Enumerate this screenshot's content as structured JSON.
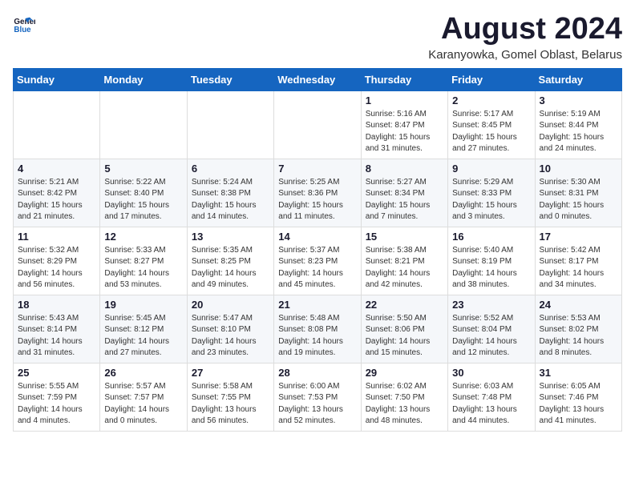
{
  "logo": {
    "line1": "General",
    "line2": "Blue"
  },
  "title": {
    "month_year": "August 2024",
    "location": "Karanyowka, Gomel Oblast, Belarus"
  },
  "weekdays": [
    "Sunday",
    "Monday",
    "Tuesday",
    "Wednesday",
    "Thursday",
    "Friday",
    "Saturday"
  ],
  "weeks": [
    [
      {
        "day": "",
        "sunrise": "",
        "sunset": "",
        "daylight": ""
      },
      {
        "day": "",
        "sunrise": "",
        "sunset": "",
        "daylight": ""
      },
      {
        "day": "",
        "sunrise": "",
        "sunset": "",
        "daylight": ""
      },
      {
        "day": "",
        "sunrise": "",
        "sunset": "",
        "daylight": ""
      },
      {
        "day": "1",
        "sunrise": "Sunrise: 5:16 AM",
        "sunset": "Sunset: 8:47 PM",
        "daylight": "Daylight: 15 hours and 31 minutes."
      },
      {
        "day": "2",
        "sunrise": "Sunrise: 5:17 AM",
        "sunset": "Sunset: 8:45 PM",
        "daylight": "Daylight: 15 hours and 27 minutes."
      },
      {
        "day": "3",
        "sunrise": "Sunrise: 5:19 AM",
        "sunset": "Sunset: 8:44 PM",
        "daylight": "Daylight: 15 hours and 24 minutes."
      }
    ],
    [
      {
        "day": "4",
        "sunrise": "Sunrise: 5:21 AM",
        "sunset": "Sunset: 8:42 PM",
        "daylight": "Daylight: 15 hours and 21 minutes."
      },
      {
        "day": "5",
        "sunrise": "Sunrise: 5:22 AM",
        "sunset": "Sunset: 8:40 PM",
        "daylight": "Daylight: 15 hours and 17 minutes."
      },
      {
        "day": "6",
        "sunrise": "Sunrise: 5:24 AM",
        "sunset": "Sunset: 8:38 PM",
        "daylight": "Daylight: 15 hours and 14 minutes."
      },
      {
        "day": "7",
        "sunrise": "Sunrise: 5:25 AM",
        "sunset": "Sunset: 8:36 PM",
        "daylight": "Daylight: 15 hours and 11 minutes."
      },
      {
        "day": "8",
        "sunrise": "Sunrise: 5:27 AM",
        "sunset": "Sunset: 8:34 PM",
        "daylight": "Daylight: 15 hours and 7 minutes."
      },
      {
        "day": "9",
        "sunrise": "Sunrise: 5:29 AM",
        "sunset": "Sunset: 8:33 PM",
        "daylight": "Daylight: 15 hours and 3 minutes."
      },
      {
        "day": "10",
        "sunrise": "Sunrise: 5:30 AM",
        "sunset": "Sunset: 8:31 PM",
        "daylight": "Daylight: 15 hours and 0 minutes."
      }
    ],
    [
      {
        "day": "11",
        "sunrise": "Sunrise: 5:32 AM",
        "sunset": "Sunset: 8:29 PM",
        "daylight": "Daylight: 14 hours and 56 minutes."
      },
      {
        "day": "12",
        "sunrise": "Sunrise: 5:33 AM",
        "sunset": "Sunset: 8:27 PM",
        "daylight": "Daylight: 14 hours and 53 minutes."
      },
      {
        "day": "13",
        "sunrise": "Sunrise: 5:35 AM",
        "sunset": "Sunset: 8:25 PM",
        "daylight": "Daylight: 14 hours and 49 minutes."
      },
      {
        "day": "14",
        "sunrise": "Sunrise: 5:37 AM",
        "sunset": "Sunset: 8:23 PM",
        "daylight": "Daylight: 14 hours and 45 minutes."
      },
      {
        "day": "15",
        "sunrise": "Sunrise: 5:38 AM",
        "sunset": "Sunset: 8:21 PM",
        "daylight": "Daylight: 14 hours and 42 minutes."
      },
      {
        "day": "16",
        "sunrise": "Sunrise: 5:40 AM",
        "sunset": "Sunset: 8:19 PM",
        "daylight": "Daylight: 14 hours and 38 minutes."
      },
      {
        "day": "17",
        "sunrise": "Sunrise: 5:42 AM",
        "sunset": "Sunset: 8:17 PM",
        "daylight": "Daylight: 14 hours and 34 minutes."
      }
    ],
    [
      {
        "day": "18",
        "sunrise": "Sunrise: 5:43 AM",
        "sunset": "Sunset: 8:14 PM",
        "daylight": "Daylight: 14 hours and 31 minutes."
      },
      {
        "day": "19",
        "sunrise": "Sunrise: 5:45 AM",
        "sunset": "Sunset: 8:12 PM",
        "daylight": "Daylight: 14 hours and 27 minutes."
      },
      {
        "day": "20",
        "sunrise": "Sunrise: 5:47 AM",
        "sunset": "Sunset: 8:10 PM",
        "daylight": "Daylight: 14 hours and 23 minutes."
      },
      {
        "day": "21",
        "sunrise": "Sunrise: 5:48 AM",
        "sunset": "Sunset: 8:08 PM",
        "daylight": "Daylight: 14 hours and 19 minutes."
      },
      {
        "day": "22",
        "sunrise": "Sunrise: 5:50 AM",
        "sunset": "Sunset: 8:06 PM",
        "daylight": "Daylight: 14 hours and 15 minutes."
      },
      {
        "day": "23",
        "sunrise": "Sunrise: 5:52 AM",
        "sunset": "Sunset: 8:04 PM",
        "daylight": "Daylight: 14 hours and 12 minutes."
      },
      {
        "day": "24",
        "sunrise": "Sunrise: 5:53 AM",
        "sunset": "Sunset: 8:02 PM",
        "daylight": "Daylight: 14 hours and 8 minutes."
      }
    ],
    [
      {
        "day": "25",
        "sunrise": "Sunrise: 5:55 AM",
        "sunset": "Sunset: 7:59 PM",
        "daylight": "Daylight: 14 hours and 4 minutes."
      },
      {
        "day": "26",
        "sunrise": "Sunrise: 5:57 AM",
        "sunset": "Sunset: 7:57 PM",
        "daylight": "Daylight: 14 hours and 0 minutes."
      },
      {
        "day": "27",
        "sunrise": "Sunrise: 5:58 AM",
        "sunset": "Sunset: 7:55 PM",
        "daylight": "Daylight: 13 hours and 56 minutes."
      },
      {
        "day": "28",
        "sunrise": "Sunrise: 6:00 AM",
        "sunset": "Sunset: 7:53 PM",
        "daylight": "Daylight: 13 hours and 52 minutes."
      },
      {
        "day": "29",
        "sunrise": "Sunrise: 6:02 AM",
        "sunset": "Sunset: 7:50 PM",
        "daylight": "Daylight: 13 hours and 48 minutes."
      },
      {
        "day": "30",
        "sunrise": "Sunrise: 6:03 AM",
        "sunset": "Sunset: 7:48 PM",
        "daylight": "Daylight: 13 hours and 44 minutes."
      },
      {
        "day": "31",
        "sunrise": "Sunrise: 6:05 AM",
        "sunset": "Sunset: 7:46 PM",
        "daylight": "Daylight: 13 hours and 41 minutes."
      }
    ]
  ]
}
